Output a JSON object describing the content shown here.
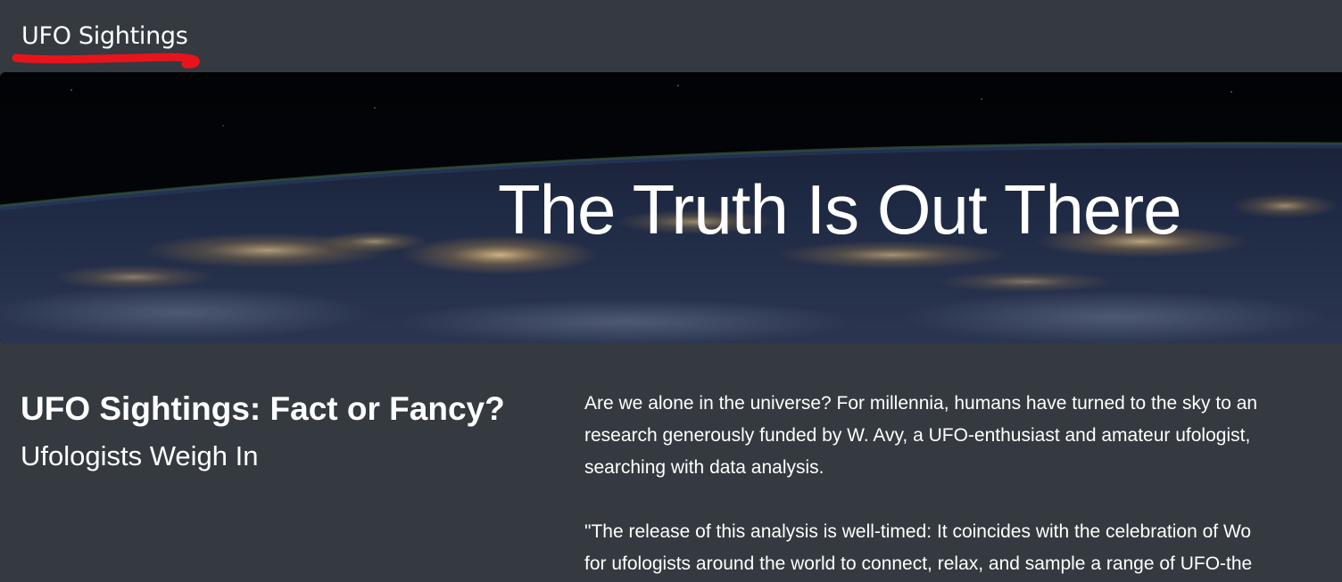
{
  "navbar": {
    "brand": "UFO Sightings"
  },
  "hero": {
    "title": "The Truth Is Out There"
  },
  "article": {
    "title": "UFO Sightings: Fact or Fancy?",
    "subtitle": "Ufologists Weigh In",
    "paragraph1_lines": [
      "Are we alone in the universe? For millennia, humans have turned to the sky to an",
      "research generously funded by W. Avy, a UFO-enthusiast and amateur ufologist,",
      "searching with data analysis."
    ],
    "paragraph2_lines": [
      "\"The release of this analysis is well-timed: It coincides with the celebration of Wo",
      "for ufologists around the world to connect, relax, and sample a range of UFO-the"
    ]
  },
  "colors": {
    "page_background": "#343a40",
    "text": "#ffffff",
    "annotation_underline": "#e8141c"
  }
}
